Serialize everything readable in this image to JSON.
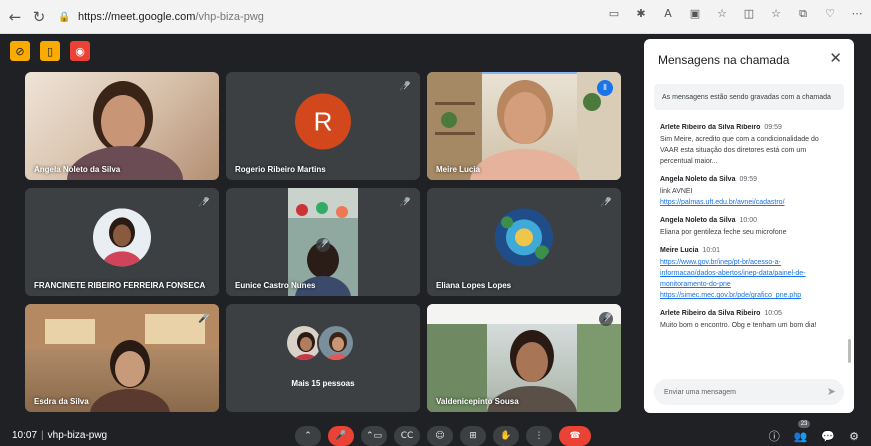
{
  "browser": {
    "url_host": "https://meet.google.com",
    "url_path": "/vhp-biza-pwg"
  },
  "tiles": [
    {
      "name": "Angela Noleto da Silva"
    },
    {
      "name": "Rogerio Ribeiro Martins",
      "avatar_letter": "R"
    },
    {
      "name": "Meire Lucia"
    },
    {
      "name": "FRANCINETE RIBEIRO FERREIRA FONSECA"
    },
    {
      "name": "Eunice Castro Nunes"
    },
    {
      "name": "Eliana Lopes Lopes"
    },
    {
      "name": "Esdra da Silva"
    },
    {
      "name": "Mais 15 pessoas"
    },
    {
      "name": "Valdenicepinto Sousa"
    }
  ],
  "chat": {
    "title": "Mensagens na chamada",
    "note": "As mensagens estão sendo gravadas com a chamada",
    "input_placeholder": "Enviar uma mensagem",
    "messages": [
      {
        "author": "Arlete Ribeiro da Silva Ribeiro",
        "time": "09:59",
        "lines": [
          "Sim Meire, acredito que com a condicionalidade do",
          "VAAR esta situação dos diretores está com um",
          "percentual maior..."
        ]
      },
      {
        "author": "Angela Noleto da Silva",
        "time": "09:59",
        "lines": [
          "link AVNEI"
        ],
        "links": [
          "https://palmas.uft.edu.br/avnei/cadastro/"
        ]
      },
      {
        "author": "Angela Noleto da Silva",
        "time": "10:00",
        "lines": [
          "Eliana por gentileza feche seu microfone"
        ]
      },
      {
        "author": "Meire Lucia",
        "time": "10:01",
        "links": [
          "https://www.gov.br/inep/pt-br/acesso-a-",
          "informacao/dados-abertos/inep-data/painel-de-",
          "monitoramento-do-pne",
          "https://simec.mec.gov.br/pde/grafico_pne.php"
        ]
      },
      {
        "author": "Arlete Ribeiro da Silva Ribeiro",
        "time": "10:05",
        "lines": [
          "Muito bom o encontro. Obg e tenham um bom dia!"
        ]
      }
    ]
  },
  "bottom": {
    "time": "10:07",
    "separator": "|",
    "meeting_code": "vhp-biza-pwg",
    "participants_count": "23"
  },
  "colors": {
    "meet_bg": "#202124",
    "tile_bg": "#3c4043",
    "accent_blue": "#1a73e8",
    "end_call_red": "#ea4335",
    "host_control_yellow": "#f9ab00"
  }
}
